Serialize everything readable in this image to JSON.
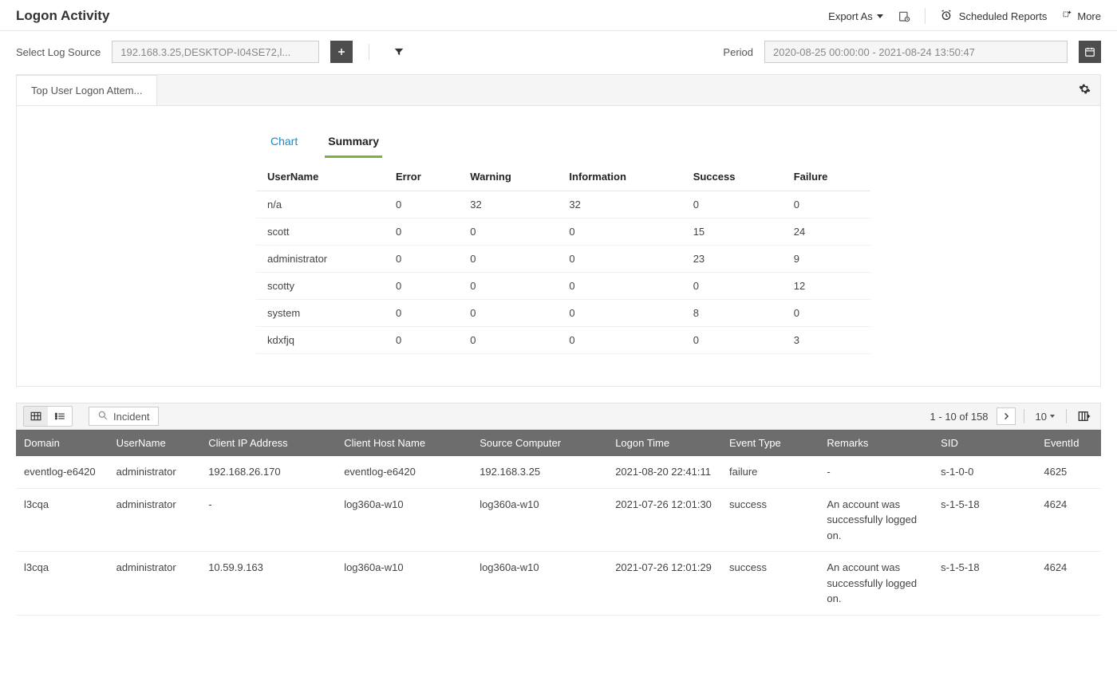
{
  "header": {
    "title": "Logon Activity",
    "export_label": "Export As",
    "scheduled_label": "Scheduled Reports",
    "more_label": "More"
  },
  "filter": {
    "source_label": "Select Log Source",
    "source_value": "192.168.3.25,DESKTOP-I04SE72,l...",
    "period_label": "Period",
    "period_value": "2020-08-25 00:00:00 - 2021-08-24 13:50:47"
  },
  "panel": {
    "tab_label": "Top User Logon Attem...",
    "sub_tabs": {
      "chart": "Chart",
      "summary": "Summary"
    },
    "active_sub_tab": "summary"
  },
  "summary": {
    "headers": [
      "UserName",
      "Error",
      "Warning",
      "Information",
      "Success",
      "Failure"
    ],
    "rows": [
      [
        "n/a",
        "0",
        "32",
        "32",
        "0",
        "0"
      ],
      [
        "scott",
        "0",
        "0",
        "0",
        "15",
        "24"
      ],
      [
        "administrator",
        "0",
        "0",
        "0",
        "23",
        "9"
      ],
      [
        "scotty",
        "0",
        "0",
        "0",
        "0",
        "12"
      ],
      [
        "system",
        "0",
        "0",
        "0",
        "8",
        "0"
      ],
      [
        "kdxfjq",
        "0",
        "0",
        "0",
        "0",
        "3"
      ]
    ]
  },
  "events_toolbar": {
    "incident_label": "Incident",
    "pagination": "1 - 10 of 158",
    "page_size": "10"
  },
  "events": {
    "headers": [
      "Domain",
      "UserName",
      "Client IP Address",
      "Client Host Name",
      "Source Computer",
      "Logon Time",
      "Event Type",
      "Remarks",
      "SID",
      "EventId"
    ],
    "rows": [
      {
        "domain": "eventlog-e6420",
        "user": "administrator",
        "ip": "192.168.26.170",
        "host": "eventlog-e6420",
        "source": "192.168.3.25",
        "time": "2021-08-20 22:41:11",
        "type": "failure",
        "remarks": "-",
        "sid": "s-1-0-0",
        "eventid": "4625"
      },
      {
        "domain": "l3cqa",
        "user": "administrator",
        "ip": "-",
        "host": "log360a-w10",
        "source": "log360a-w10",
        "time": "2021-07-26 12:01:30",
        "type": "success",
        "remarks": "An account was successfully logged on.",
        "sid": "s-1-5-18",
        "eventid": "4624"
      },
      {
        "domain": "l3cqa",
        "user": "administrator",
        "ip": "10.59.9.163",
        "host": "log360a-w10",
        "source": "log360a-w10",
        "time": "2021-07-26 12:01:29",
        "type": "success",
        "remarks": "An account was successfully logged on.",
        "sid": "s-1-5-18",
        "eventid": "4624"
      }
    ]
  }
}
